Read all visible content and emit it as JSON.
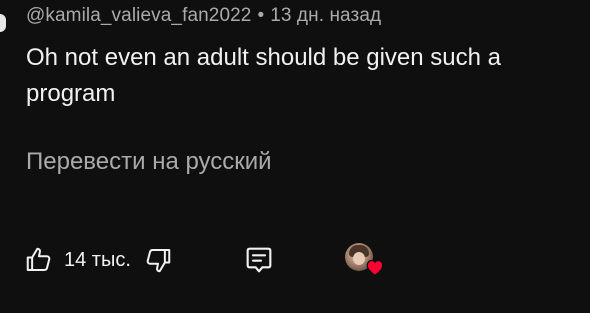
{
  "comment": {
    "author": "@kamila_valieva_fan2022",
    "separator": "•",
    "timestamp": "13 дн. назад",
    "text": "Oh not even an adult should be given such a program",
    "translate_label": "Перевести на русский"
  },
  "actions": {
    "like_count": "14 тыс.",
    "icons": {
      "like": "thumbs-up-icon",
      "dislike": "thumbs-down-icon",
      "reply": "comment-reply-icon",
      "creator_heart": "heart-icon"
    }
  },
  "colors": {
    "background": "#0f0f0f",
    "primary_text": "#f1f1f1",
    "secondary_text": "#aaaaaa",
    "heart": "#ff0033"
  }
}
